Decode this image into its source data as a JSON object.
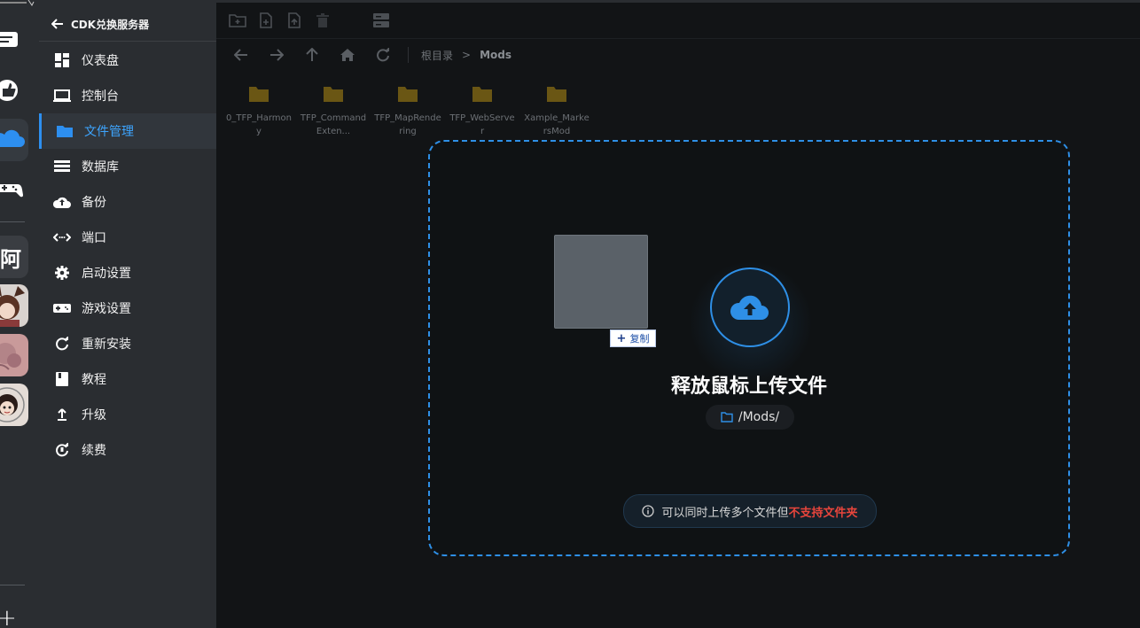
{
  "sidebar": {
    "back_label": "CDK兑换服务器",
    "items": [
      {
        "label": "仪表盘",
        "icon": "dashboard-icon"
      },
      {
        "label": "控制台",
        "icon": "laptop-icon"
      },
      {
        "label": "文件管理",
        "icon": "folder-icon",
        "active": true
      },
      {
        "label": "数据库",
        "icon": "database-icon"
      },
      {
        "label": "备份",
        "icon": "cloud-upload-icon"
      },
      {
        "label": "端口",
        "icon": "port-icon"
      },
      {
        "label": "启动设置",
        "icon": "gear-icon"
      },
      {
        "label": "游戏设置",
        "icon": "gamepad-icon"
      },
      {
        "label": "重新安装",
        "icon": "refresh-icon"
      },
      {
        "label": "教程",
        "icon": "book-icon"
      },
      {
        "label": "升级",
        "icon": "upgrade-icon"
      },
      {
        "label": "续费",
        "icon": "renew-icon"
      }
    ]
  },
  "rail": {
    "avatar_text": "阿",
    "add_label": "+"
  },
  "breadcrumb": {
    "root": "根目录",
    "separator": ">",
    "current": "Mods"
  },
  "files": [
    {
      "name": "0_TFP_Harmony"
    },
    {
      "name": "TFP_CommandExten..."
    },
    {
      "name": "TFP_MapRendering"
    },
    {
      "name": "TFP_WebServer"
    },
    {
      "name": "Xample_MarkersMod"
    }
  ],
  "drop_overlay": {
    "title": "释放鼠标上传文件",
    "path": "/Mods/",
    "hint_prefix": "可以同时上传多个文件但",
    "hint_warning": "不支持文件夹"
  },
  "drag_badge": {
    "label": "复制",
    "plus": "+"
  },
  "colors": {
    "accent": "#2e8fe6",
    "warning": "#e8453c",
    "folder": "#6a5614"
  }
}
